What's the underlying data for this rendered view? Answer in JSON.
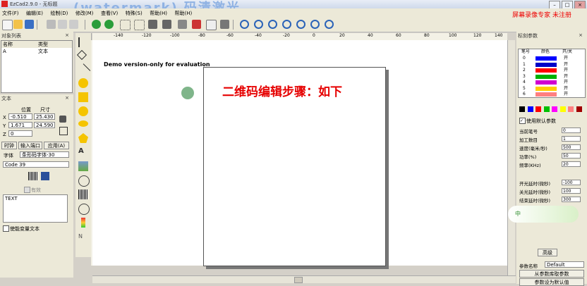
{
  "window": {
    "title": "EzCad2.9.0 - 无标题",
    "watermark": "(watermark) 码清激光",
    "record_badge": "屏幕录像专家 未注册"
  },
  "menu": [
    "文件(F)",
    "编辑(E)",
    "绘制(D)",
    "修改(M)",
    "查看(V)",
    "特殊(S)",
    "帮助(H)",
    "帮助(H)"
  ],
  "object_list": {
    "title": "对象列表",
    "col_name": "名称",
    "col_type": "类型",
    "rows": [
      {
        "name": "A",
        "type": "文本"
      }
    ]
  },
  "text_panel": {
    "title": "文本",
    "pos_label": "位置",
    "size_label": "尺寸",
    "x_label": "X",
    "y_label": "Y",
    "z_label": "Z",
    "x_pos": "-0.510",
    "x_size": "25.430",
    "y_pos": "1.671",
    "y_size": "24.590",
    "z_val": "0",
    "tabs": [
      "时钟",
      "输入端口",
      "应用(A)"
    ],
    "font_label": "字体",
    "font_value": "条形码字体-30",
    "barcode_type": "Code 39",
    "enabled_label": "有效",
    "text_value": "TEXT",
    "variable_label": "使能变量文本"
  },
  "canvas": {
    "demo_text": "Demo version-only for evaluation",
    "heading": "二维码编辑步骤：如下",
    "ruler_ticks": [
      "-140",
      "-120",
      "-100",
      "-80",
      "-60",
      "-40",
      "-20",
      "0",
      "20",
      "40",
      "60",
      "80",
      "100",
      "120",
      "140"
    ]
  },
  "params": {
    "title": "标刻参数",
    "col_no": "笔号",
    "col_color": "颜色",
    "col_onoff": "开/关",
    "pens": [
      {
        "no": "0",
        "color": "#0000ff",
        "on": "开"
      },
      {
        "no": "1",
        "color": "#0000c8",
        "on": "开"
      },
      {
        "no": "2",
        "color": "#ff0000",
        "on": "开"
      },
      {
        "no": "3",
        "color": "#00b000",
        "on": "开"
      },
      {
        "no": "4",
        "color": "#d000d0",
        "on": "开"
      },
      {
        "no": "5",
        "color": "#ffd000",
        "on": "开"
      },
      {
        "no": "6",
        "color": "#ff8080",
        "on": "开"
      }
    ],
    "palette": [
      "#000000",
      "#0000ff",
      "#ff0000",
      "#00c000",
      "#ff00ff",
      "#ffff00",
      "#ff8080",
      "#a00000"
    ],
    "use_default_label": "使用默认参数",
    "rows": [
      {
        "label": "当前笔号",
        "value": "0"
      },
      {
        "label": "加工数目",
        "value": "1"
      },
      {
        "label": "速度(毫米/秒)",
        "value": "500"
      },
      {
        "label": "功率(%)",
        "value": "50"
      },
      {
        "label": "频率(KHz)",
        "value": "20"
      },
      {
        "label": "开光延时(微秒)",
        "value": "-100"
      },
      {
        "label": "关光延时(微秒)",
        "value": "100"
      },
      {
        "label": "结束延时(微秒)",
        "value": "300"
      }
    ],
    "advanced": "高级",
    "param_lib": "参数名称",
    "param_default": "Default",
    "load_btn": "从参数库取参数",
    "save_btn": "参数设为默认值",
    "ime": "中"
  },
  "colors": {
    "accent": "#0078d7",
    "heading_red": "#e60000"
  }
}
